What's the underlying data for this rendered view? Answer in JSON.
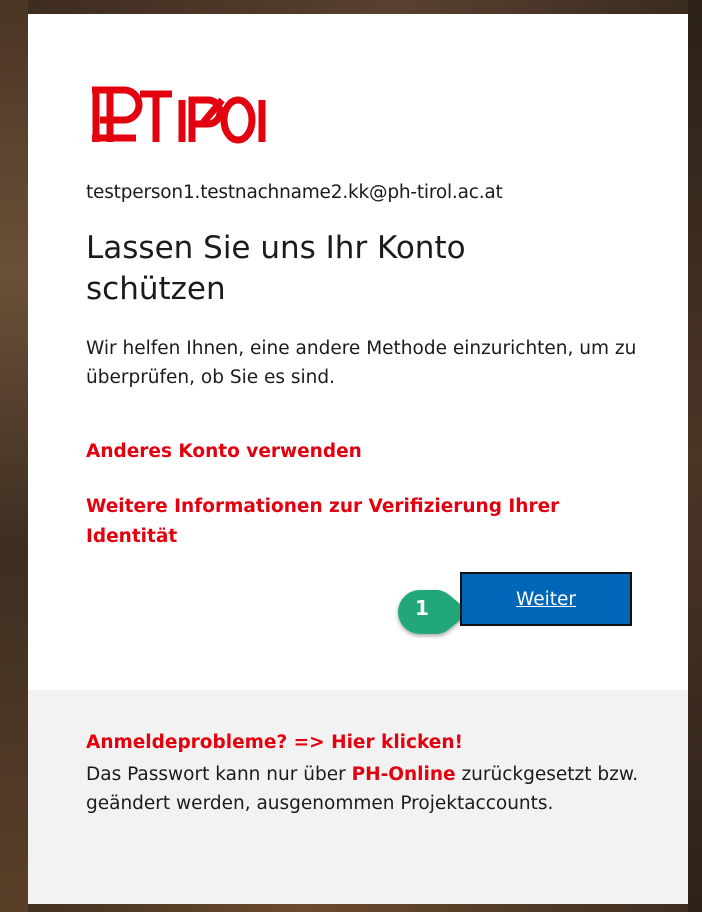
{
  "brand": {
    "logo_text": "PH TIROL",
    "accent_color": "#e3000f",
    "button_color": "#0067b8"
  },
  "account": {
    "email": "testperson1.testnachname2.kk@ph-tirol.ac.at"
  },
  "main": {
    "title": "Lassen Sie uns Ihr Konto schützen",
    "description": "Wir helfen Ihnen, eine andere Methode einzurichten, um zu überprüfen, ob Sie es sind.",
    "link_other_account": "Anderes Konto verwenden",
    "link_more_info": "Weitere Informationen zur Verifizierung Ihrer Identität",
    "next_button_label": "Weiter",
    "step_marker": "1"
  },
  "footer": {
    "headline": "Anmeldeprobleme? => Hier klicken!",
    "text_before": "Das Passwort kann nur über ",
    "highlight": "PH-Online",
    "text_after": " zurückgesetzt bzw. geändert werden, ausgenommen Projektaccounts."
  }
}
